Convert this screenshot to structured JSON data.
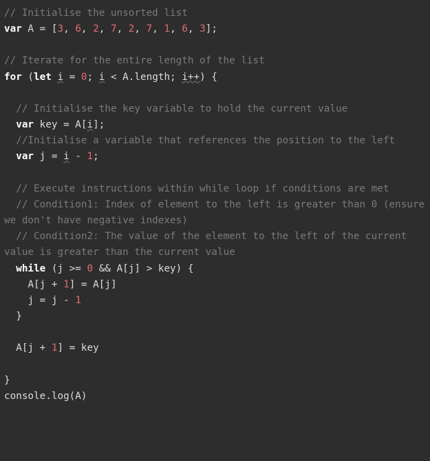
{
  "code": {
    "tokens": [
      [
        {
          "t": "// Initialise the unsorted list",
          "c": "comment"
        }
      ],
      [
        {
          "t": "var",
          "c": "keyword"
        },
        {
          "t": " A ",
          "c": "varname"
        },
        {
          "t": "=",
          "c": "op"
        },
        {
          "t": " [",
          "c": "bracket"
        },
        {
          "t": "3",
          "c": "number"
        },
        {
          "t": ", ",
          "c": "op"
        },
        {
          "t": "6",
          "c": "number"
        },
        {
          "t": ", ",
          "c": "op"
        },
        {
          "t": "2",
          "c": "number"
        },
        {
          "t": ", ",
          "c": "op"
        },
        {
          "t": "7",
          "c": "number"
        },
        {
          "t": ", ",
          "c": "op"
        },
        {
          "t": "2",
          "c": "number"
        },
        {
          "t": ", ",
          "c": "op"
        },
        {
          "t": "7",
          "c": "number"
        },
        {
          "t": ", ",
          "c": "op"
        },
        {
          "t": "1",
          "c": "number"
        },
        {
          "t": ", ",
          "c": "op"
        },
        {
          "t": "6",
          "c": "number"
        },
        {
          "t": ", ",
          "c": "op"
        },
        {
          "t": "3",
          "c": "number"
        },
        {
          "t": "];",
          "c": "bracket"
        }
      ],
      [
        {
          "t": "",
          "c": "var"
        }
      ],
      [
        {
          "t": "// Iterate for the entire length of the list",
          "c": "comment"
        }
      ],
      [
        {
          "t": "for",
          "c": "keyword"
        },
        {
          "t": " (",
          "c": "bracket"
        },
        {
          "t": "let",
          "c": "keyword"
        },
        {
          "t": " ",
          "c": "var"
        },
        {
          "t": "i",
          "c": "varname",
          "w": true
        },
        {
          "t": " ",
          "c": "var"
        },
        {
          "t": "=",
          "c": "op"
        },
        {
          "t": " ",
          "c": "var"
        },
        {
          "t": "0",
          "c": "number"
        },
        {
          "t": "; ",
          "c": "op"
        },
        {
          "t": "i",
          "c": "varname",
          "w": true
        },
        {
          "t": " ",
          "c": "var"
        },
        {
          "t": "<",
          "c": "op"
        },
        {
          "t": " A.length; ",
          "c": "varname"
        },
        {
          "t": "i++",
          "c": "varname",
          "w": true
        },
        {
          "t": ") {",
          "c": "bracket"
        }
      ],
      [
        {
          "t": "",
          "c": "var"
        }
      ],
      [
        {
          "t": "  ",
          "c": "var"
        },
        {
          "t": "// Initialise the key variable to hold the current value",
          "c": "comment"
        }
      ],
      [
        {
          "t": "  ",
          "c": "var"
        },
        {
          "t": "var",
          "c": "keyword"
        },
        {
          "t": " key ",
          "c": "varname"
        },
        {
          "t": "=",
          "c": "op"
        },
        {
          "t": " A[",
          "c": "varname"
        },
        {
          "t": "i",
          "c": "varname",
          "w": true
        },
        {
          "t": "];",
          "c": "bracket"
        }
      ],
      [
        {
          "t": "  ",
          "c": "var"
        },
        {
          "t": "//Initialise a variable that references the position to the left",
          "c": "comment"
        }
      ],
      [
        {
          "t": "  ",
          "c": "var"
        },
        {
          "t": "var",
          "c": "keyword"
        },
        {
          "t": " j ",
          "c": "varname"
        },
        {
          "t": "=",
          "c": "op"
        },
        {
          "t": " ",
          "c": "var"
        },
        {
          "t": "i",
          "c": "varname",
          "w": true
        },
        {
          "t": " ",
          "c": "var"
        },
        {
          "t": "-",
          "c": "op"
        },
        {
          "t": " ",
          "c": "var"
        },
        {
          "t": "1",
          "c": "number"
        },
        {
          "t": ";",
          "c": "op"
        }
      ],
      [
        {
          "t": "",
          "c": "var"
        }
      ],
      [
        {
          "t": "  ",
          "c": "var"
        },
        {
          "t": "// Execute instructions within while loop if conditions are met",
          "c": "comment"
        }
      ],
      [
        {
          "t": "  ",
          "c": "var"
        },
        {
          "t": "// Condition1: Index of element to the left is greater than 0 (ensure we don't have negative indexes)",
          "c": "comment"
        }
      ],
      [
        {
          "t": "  ",
          "c": "var"
        },
        {
          "t": "// Condition2: The value of the element to the left of the current value is greater than the current value",
          "c": "comment"
        }
      ],
      [
        {
          "t": "  ",
          "c": "var"
        },
        {
          "t": "while",
          "c": "keyword"
        },
        {
          "t": " (j ",
          "c": "varname"
        },
        {
          "t": ">=",
          "c": "op"
        },
        {
          "t": " ",
          "c": "var"
        },
        {
          "t": "0",
          "c": "number"
        },
        {
          "t": " ",
          "c": "var"
        },
        {
          "t": "&&",
          "c": "op"
        },
        {
          "t": " A[j] ",
          "c": "varname"
        },
        {
          "t": ">",
          "c": "op"
        },
        {
          "t": " key) {",
          "c": "varname"
        }
      ],
      [
        {
          "t": "    A[j ",
          "c": "varname"
        },
        {
          "t": "+",
          "c": "op"
        },
        {
          "t": " ",
          "c": "var"
        },
        {
          "t": "1",
          "c": "number"
        },
        {
          "t": "] ",
          "c": "bracket"
        },
        {
          "t": "=",
          "c": "op"
        },
        {
          "t": " A[j]",
          "c": "varname"
        }
      ],
      [
        {
          "t": "    j ",
          "c": "varname"
        },
        {
          "t": "=",
          "c": "op"
        },
        {
          "t": " j ",
          "c": "varname"
        },
        {
          "t": "-",
          "c": "op"
        },
        {
          "t": " ",
          "c": "var"
        },
        {
          "t": "1",
          "c": "number"
        }
      ],
      [
        {
          "t": "  }",
          "c": "bracket"
        }
      ],
      [
        {
          "t": "",
          "c": "var"
        }
      ],
      [
        {
          "t": "  A[j ",
          "c": "varname"
        },
        {
          "t": "+",
          "c": "op"
        },
        {
          "t": " ",
          "c": "var"
        },
        {
          "t": "1",
          "c": "number"
        },
        {
          "t": "] ",
          "c": "bracket"
        },
        {
          "t": "=",
          "c": "op"
        },
        {
          "t": " key",
          "c": "varname"
        }
      ],
      [
        {
          "t": "",
          "c": "var"
        }
      ],
      [
        {
          "t": "}",
          "c": "bracket"
        }
      ],
      [
        {
          "t": "console.log(A)",
          "c": "varname"
        }
      ]
    ]
  }
}
